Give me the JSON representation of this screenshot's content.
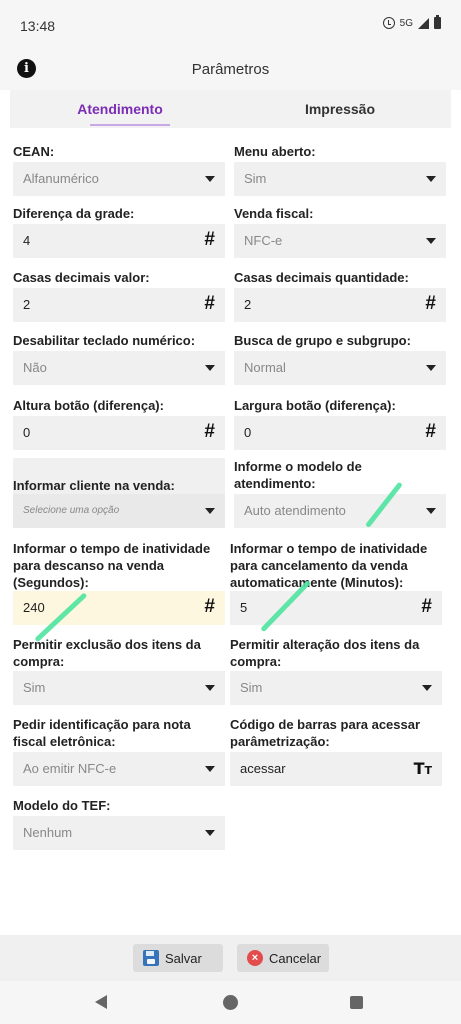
{
  "status_bar": {
    "time": "13:48",
    "network": "5G"
  },
  "header": {
    "title": "Parâmetros"
  },
  "tabs": {
    "atendimento": "Atendimento",
    "impressao": "Impressão"
  },
  "fields": {
    "cean": {
      "label": "CEAN:",
      "value": "Alfanumérico"
    },
    "menu_aberto": {
      "label": "Menu aberto:",
      "value": "Sim"
    },
    "diferenca_grade": {
      "label": "Diferença da grade:",
      "value": "4"
    },
    "venda_fiscal": {
      "label": "Venda fiscal:",
      "value": "NFC-e"
    },
    "casas_valor": {
      "label": "Casas decimais valor:",
      "value": "2"
    },
    "casas_quantidade": {
      "label": "Casas decimais quantidade:",
      "value": "2"
    },
    "desabilitar_teclado": {
      "label": "Desabilitar teclado numérico:",
      "value": "Não"
    },
    "busca_grupo": {
      "label": "Busca de grupo e subgrupo:",
      "value": "Normal"
    },
    "altura_botao": {
      "label": "Altura botão (diferença):",
      "value": "0"
    },
    "largura_botao": {
      "label": "Largura botão (diferença):",
      "value": "0"
    },
    "informar_cliente": {
      "label": "Informar cliente na venda:",
      "placeholder": "Selecione uma opção"
    },
    "modelo_atendimento": {
      "label_line1": "Informe o modelo de",
      "label_line2": "atendimento:",
      "value": "Auto atendimento"
    },
    "tempo_descanso": {
      "label_line1": "Informar o tempo de inatividade",
      "label_line2": "para descanso na venda",
      "label_line3": "(Segundos):",
      "value": "240"
    },
    "tempo_cancelamento": {
      "label_line1": "Informar o tempo de inatividade",
      "label_line2": "para cancelamento da venda",
      "label_line3": "automaticamente (Minutos):",
      "value": "5"
    },
    "permitir_exclusao": {
      "label_line1": "Permitir exclusão dos itens da",
      "label_line2": "compra:",
      "value": "Sim"
    },
    "permitir_alteracao": {
      "label_line1": "Permitir alteração dos itens da",
      "label_line2": "compra:",
      "value": "Sim"
    },
    "pedir_identificacao": {
      "label_line1": "Pedir identificação para nota",
      "label_line2": "fiscal eletrônica:",
      "value": "Ao emitir NFC-e"
    },
    "codigo_barras": {
      "label_line1": "Código de barras para acessar",
      "label_line2": "parâmetrização:",
      "value": "acessar"
    },
    "modelo_tef": {
      "label": "Modelo do TEF:",
      "value": "Nenhum"
    }
  },
  "actions": {
    "save": "Salvar",
    "cancel": "Cancelar"
  },
  "icons": {
    "info": "info-icon",
    "dropdown": "chevron-down-icon",
    "numeric": "hash-icon",
    "text": "text-type-icon",
    "save": "floppy-disk-icon",
    "cancel": "close-circle-icon"
  },
  "colors": {
    "accent": "#7b2db5",
    "highlight_field": "#fdf7e0",
    "annotation": "#4ee39e"
  }
}
